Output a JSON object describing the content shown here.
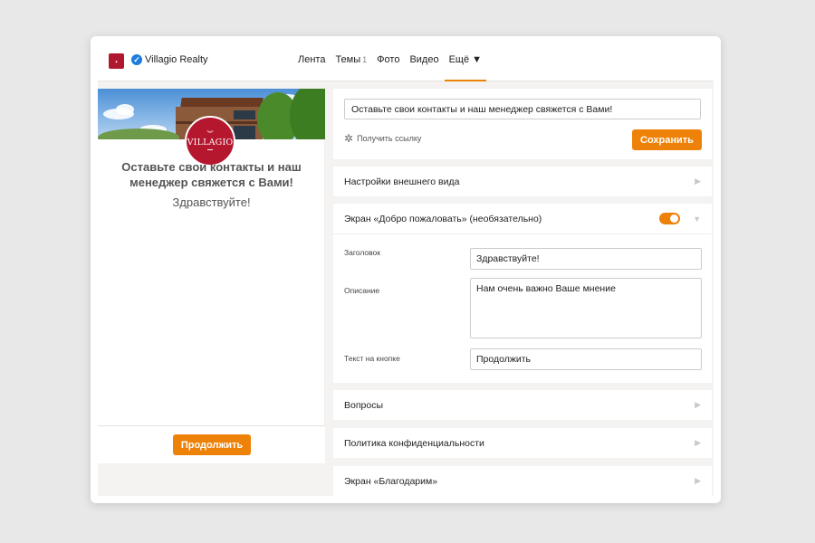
{
  "header": {
    "brand_name": "Villagio Realty",
    "nav": [
      {
        "label": "Лента"
      },
      {
        "label": "Темы",
        "count": "1"
      },
      {
        "label": "Фото"
      },
      {
        "label": "Видео"
      },
      {
        "label": "Ещё ▼",
        "active": true
      }
    ]
  },
  "preview": {
    "logo_text": "VILLAGIO",
    "title": "Оставьте свои контакты и наш менеджер свяжется с Вами!",
    "greeting": "Здравствуйте!",
    "continue_label": "Продолжить"
  },
  "editor": {
    "title_value": "Оставьте свои контакты и наш менеджер свяжется с Вами!",
    "get_link_label": "Получить ссылку",
    "save_label": "Сохранить",
    "sections": {
      "appearance": "Настройки внешнего вида",
      "welcome": "Экран «Добро пожаловать» (необязательно)",
      "questions": "Вопросы",
      "privacy": "Политика конфиденциальности",
      "thanks": "Экран «Благодарим»"
    },
    "welcome_enabled": true,
    "welcome": {
      "heading_label": "Заголовок",
      "heading_value": "Здравствуйте!",
      "description_label": "Описание",
      "description_value": "Нам очень важно Ваше мнение",
      "button_text_label": "Текст на кнопке",
      "button_text_value": "Продолжить"
    }
  },
  "colors": {
    "accent": "#ee8208",
    "brand": "#b5172f",
    "verified": "#1e7be0"
  },
  "icons": [
    "verified-check-icon",
    "gear-icon",
    "chevron-right-icon",
    "chevron-down-icon"
  ]
}
